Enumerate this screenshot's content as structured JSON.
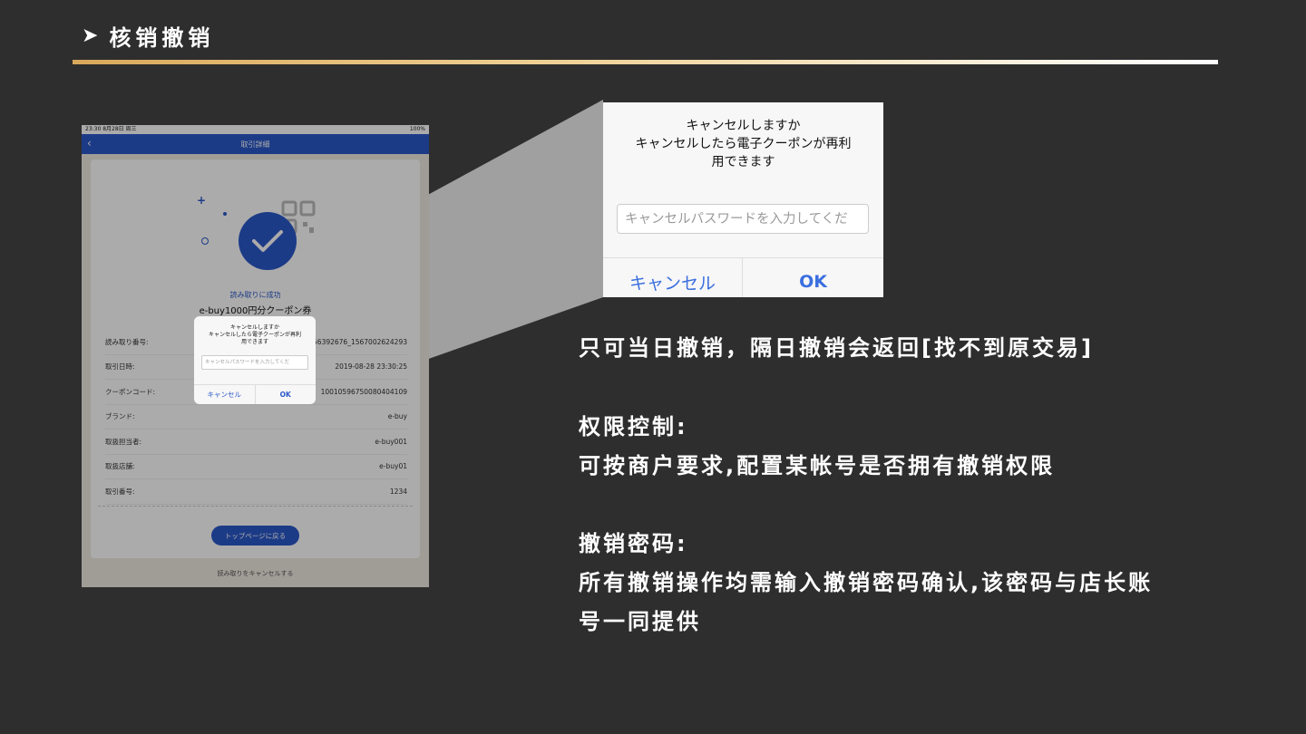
{
  "header": {
    "arrow": "➤",
    "title": "核销撤销"
  },
  "phone": {
    "status_time": "23:30  8月28日 周三",
    "status_right": "100%",
    "nav_title": "取引詳細",
    "success_text": "読み取りに成功",
    "coupon_name": "e-buy1000円分クーポン券",
    "rows": [
      {
        "label": "読み取り番号:",
        "value": "56392676_1567002624293"
      },
      {
        "label": "取引日時:",
        "value": "2019-08-28 23:30:25"
      },
      {
        "label": "クーポンコード:",
        "value": "1001059675008040410‌9"
      },
      {
        "label": "ブランド:",
        "value": "e-buy"
      },
      {
        "label": "取扱担当者:",
        "value": "e-buy001"
      },
      {
        "label": "取扱店舗:",
        "value": "e-buy01"
      },
      {
        "label": "取引番号:",
        "value": "1234"
      }
    ],
    "top_button": "トップページに戻る",
    "cancel_link": "読み取りをキャンセルする",
    "dialog": {
      "line1": "キャンセルしますか",
      "line2": "キャンセルしたら電子クーポンが再利",
      "line3": "用できます",
      "placeholder": "キャンセルパスワードを入力してくだ",
      "cancel": "キャンセル",
      "ok": "OK"
    }
  },
  "zoom_dialog": {
    "line1": "キャンセルしますか",
    "line2": "キャンセルしたら電子クーポンが再利",
    "line3": "用できます",
    "placeholder": "キャンセルパスワードを入力してくだ",
    "cancel": "キャンセル",
    "ok": "OK"
  },
  "notes": {
    "line1": "只可当日撤销，隔日撤销会返回[找不到原交易]",
    "heading2": "权限控制:",
    "line2": "可按商户要求,配置某帐号是否拥有撤销权限",
    "heading3": "撤销密码:",
    "line3a": "所有撤销操作均需输入撤销密码确认,该密码与店长账",
    "line3b": "号一同提供"
  },
  "colors": {
    "background": "#2e2e2e",
    "accent_blue": "#2a58c9",
    "rule_gold": "#d9a85a"
  }
}
